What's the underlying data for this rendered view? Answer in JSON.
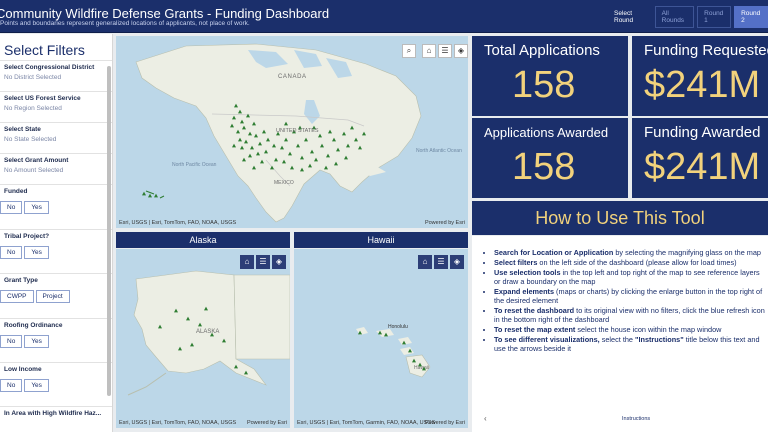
{
  "header": {
    "title": "Community Wildfire Defense Grants - Funding Dashboard",
    "subtitle": "Points and boundaries represent generalized locations of applicants, not place of work.",
    "round_label": "Select Round",
    "rounds": [
      "All Rounds",
      "Round 1",
      "Round 2"
    ]
  },
  "sidebar": {
    "title": "Select Filters",
    "filters": [
      {
        "label": "Select Congressional District",
        "value": "No District Selected"
      },
      {
        "label": "Select US Forest Service",
        "value": "No Region Selected"
      },
      {
        "label": "Select State",
        "value": "No State Selected"
      },
      {
        "label": "Select Grant Amount",
        "value": "No Amount Selected"
      }
    ],
    "funded": {
      "label": "Funded",
      "options": [
        "No",
        "Yes"
      ]
    },
    "tribal": {
      "label": "Tribal Project?",
      "options": [
        "No",
        "Yes"
      ]
    },
    "grant_type": {
      "label": "Grant Type",
      "options": [
        "CWPP",
        "Project"
      ]
    },
    "roofing": {
      "label": "Roofing Ordinance",
      "options": [
        "No",
        "Yes"
      ]
    },
    "low_income": {
      "label": "Low Income",
      "options": [
        "No",
        "Yes"
      ]
    },
    "high_hazard": {
      "label": "In Area with High Wildfire Haz..."
    }
  },
  "main_map": {
    "labels": {
      "canada": "CANADA",
      "united_states": "UNITED STATES",
      "mexico": "MEXICO",
      "north_pacific": "North Pacific Ocean",
      "north_atlantic": "North Atlantic Ocean"
    },
    "attribution": "Esri, USGS | Esri, TomTom, FAO, NOAA, USGS",
    "powered": "Powered by Esri"
  },
  "alaska_map": {
    "title": "Alaska",
    "labels": {
      "alaska": "ALASKA"
    },
    "attribution": "Esri, USGS | Esri, TomTom, FAO, NOAA, USGS",
    "powered": "Powered by Esri"
  },
  "hawaii_map": {
    "title": "Hawaii",
    "labels": {
      "honolulu": "Honolulu",
      "hawaii": "Hawaii"
    },
    "attribution": "Esri, USGS | Esri, TomTom, Garmin, FAO, NOAA, USGS",
    "powered": "Powered by Esri"
  },
  "kpis": {
    "total_apps": {
      "label": "Total Applications",
      "value": "158"
    },
    "funding_req": {
      "label": "Funding Requested",
      "value": "$241M"
    },
    "apps_awarded": {
      "label": "Applications Awarded",
      "value": "158"
    },
    "funding_awarded": {
      "label": "Funding Awarded",
      "value": "$241M"
    }
  },
  "how_to": {
    "title": "How to Use This Tool",
    "items": [
      {
        "bold": "Search for Location or Application",
        "text": " by selecting the magnifying glass on the map"
      },
      {
        "bold": "Select filters",
        "text": " on the left side of the dashboard (please allow for load times)"
      },
      {
        "bold": "Use selection tools",
        "text": " in the top left and top right of the map to see reference layers or draw a boundary on the map"
      },
      {
        "bold": "Expand elements",
        "text": " (maps or charts) by clicking the enlarge button in the top right of the desired element"
      },
      {
        "bold": "To reset the dashboard",
        "text": " to its original view with no filters, click the blue refresh icon in the bottom right of the dashboard"
      },
      {
        "bold": "To reset the map extent",
        "text": " select the house icon within the map window"
      },
      {
        "bold": "To see different visualizations,",
        "text": " select the ",
        "bold2": "\"Instructions\"",
        "text2": " title below this text and use the arrows beside it"
      }
    ],
    "footer_tab": "Instructions"
  },
  "colors": {
    "navy": "#1b2f6b",
    "gold": "#f2d27c",
    "marker": "#2e7d32"
  }
}
